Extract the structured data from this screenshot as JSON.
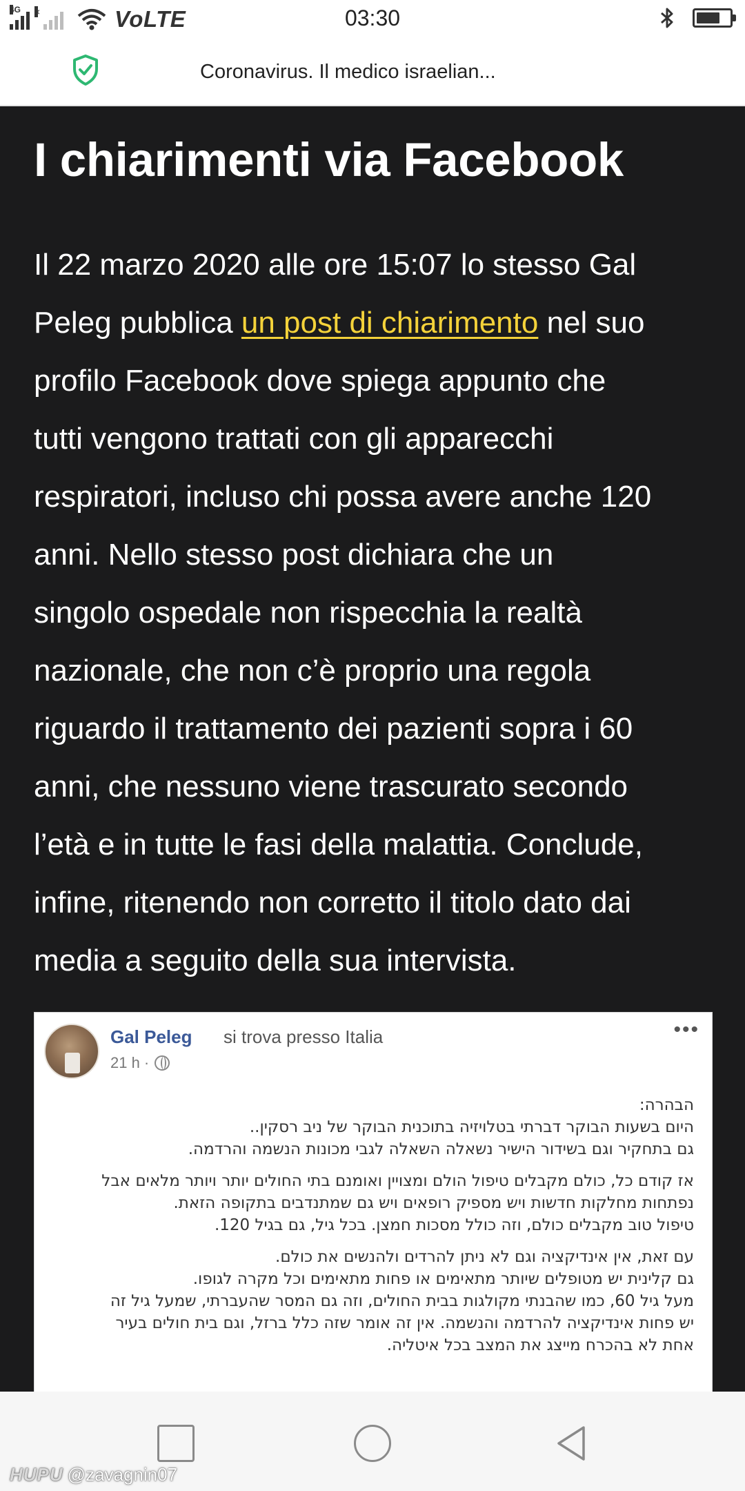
{
  "status_bar": {
    "network": "4G",
    "carrier_label": "VoLTE",
    "time": "03:30",
    "battery_level": 0.72
  },
  "address_bar": {
    "page_title": "Coronavirus. Il medico israelian..."
  },
  "article": {
    "heading": "I chiarimenti via Facebook",
    "lines": [
      [
        "Il 22 marzo 2020 alle ore 15:07 lo stesso Gal"
      ],
      [
        "Peleg pubblica ",
        "un post di chiarimento",
        " nel suo"
      ],
      [
        "profilo Facebook dove spiega appunto che"
      ],
      [
        "tutti vengono trattati con gli apparecchi"
      ],
      [
        "respiratori, incluso chi possa avere anche 120"
      ],
      [
        "anni. Nello stesso post dichiara che un"
      ],
      [
        "singolo ospedale non rispecchia la realtà"
      ],
      [
        "nazionale, che non c’è proprio una regola"
      ],
      [
        "riguardo il trattamento dei pazienti sopra i 60"
      ],
      [
        "anni, che nessuno viene trascurato secondo"
      ],
      [
        "l’età e in tutte le fasi della malattia. Conclude,"
      ],
      [
        "infine, ritenendo non corretto il titolo dato dai"
      ],
      [
        "media a seguito della sua intervista."
      ]
    ],
    "link_color": "#f4d23a"
  },
  "facebook_post": {
    "author": "Gal Peleg",
    "location_text": "si trova presso Italia",
    "time": "21 h ·",
    "more_label": "•••",
    "paragraphs": [
      [
        "הבהרה:",
        "היום בשעות הבוקר דברתי בטלויזיה בתוכנית הבוקר של ניב רסקין..",
        "גם בתחקיר וגם בשידור הישיר נשאלה השאלה לגבי מכונות הנשמה והרדמה."
      ],
      [
        "אז קודם כל, כולם מקבלים טיפול הולם ומצויין ואומנם בתי החולים יותר ויותר מלאים אבל",
        "נפתחות מחלקות חדשות ויש מספיק רופאים ויש גם שמתנדבים בתקופה הזאת.",
        "טיפול טוב מקבלים כולם, וזה כולל מסכות חמצן. בכל גיל, גם בגיל 120."
      ],
      [
        "עם זאת, אין אינדיקציה וגם לא ניתן להרדים ולהנשים את כולם.",
        "גם קלינית יש מטופלים שיותר מתאימים או פחות מתאימים וכל מקרה לגופו.",
        "מעל גיל 60, כמו שהבנתי מקולגות בבית החולים, וזה גם המסר שהעברתי, שמעל גיל זה",
        "יש פחות אינדיקציה להרדמה והנשמה. אין זה אומר שזה כלל ברזל, וגם בית חולים בעיר",
        "אחת לא בהכרח מייצג את המצב בכל איטליה."
      ]
    ]
  },
  "watermark": {
    "logo": "HUPU",
    "handle": "@zavagnin07"
  }
}
